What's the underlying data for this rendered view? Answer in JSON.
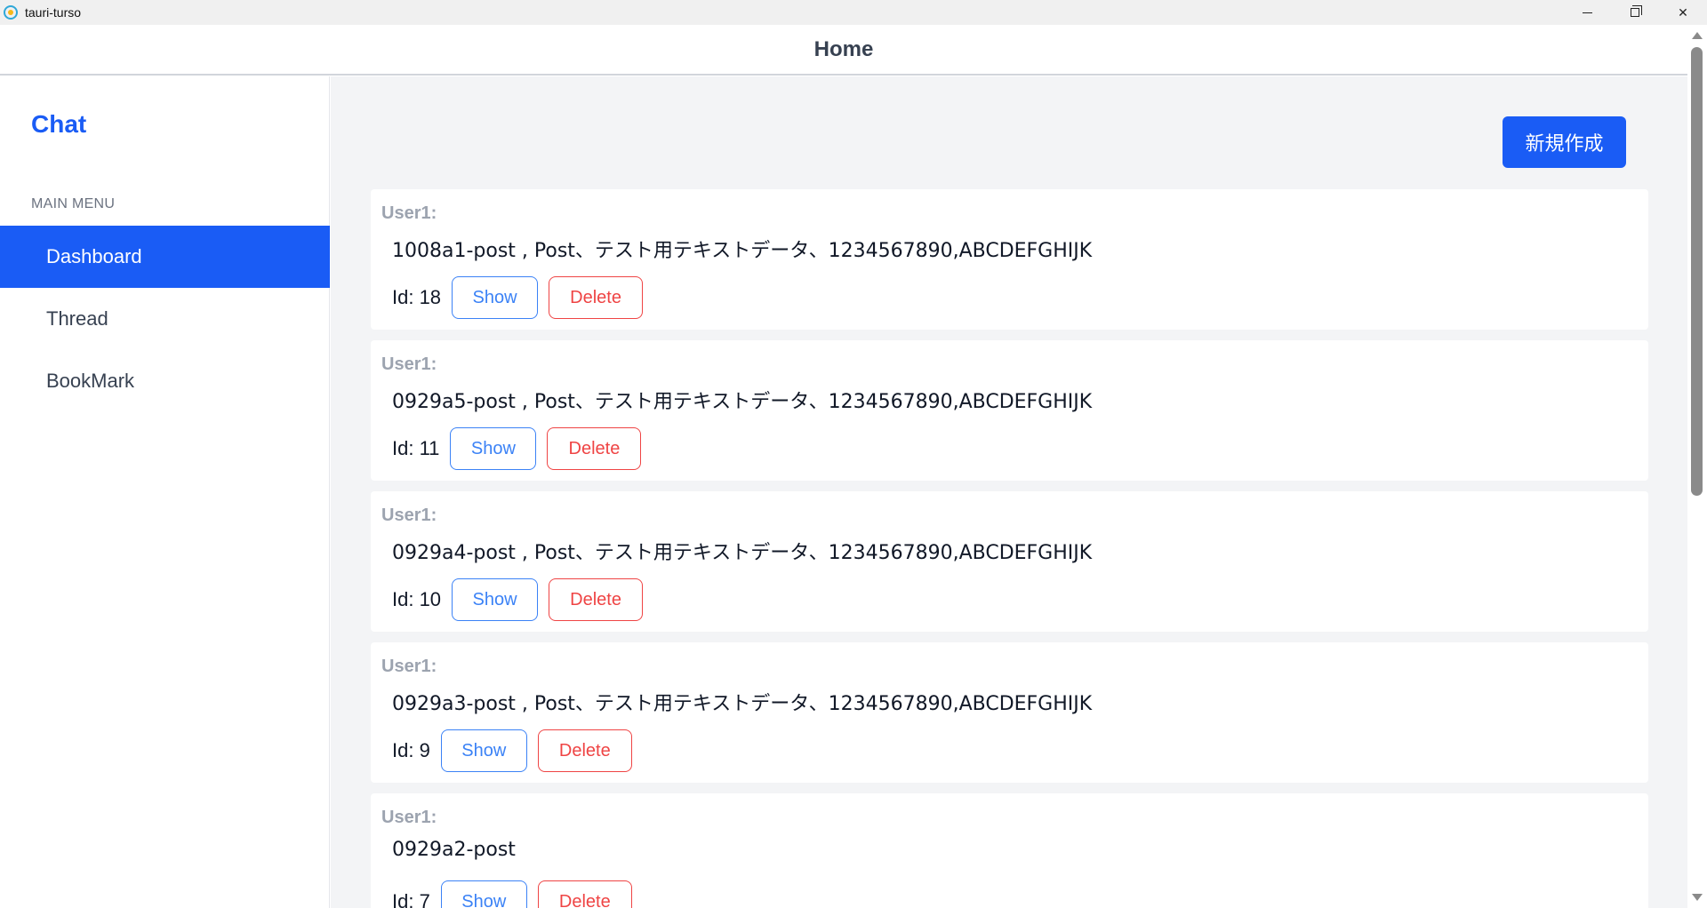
{
  "window": {
    "title": "tauri-turso",
    "icon": "tauri-app-icon",
    "controls": {
      "minimize": "minimize-icon",
      "maximize": "restore-icon",
      "close": "✕"
    }
  },
  "header": {
    "title": "Home"
  },
  "sidebar": {
    "brand": "Chat",
    "menu_heading": "MAIN MENU",
    "items": [
      {
        "label": "Dashboard",
        "active": true
      },
      {
        "label": "Thread",
        "active": false
      },
      {
        "label": "BookMark",
        "active": false
      }
    ]
  },
  "main": {
    "new_button_label": "新規作成",
    "posts": [
      {
        "user": "User1:",
        "body": "1008a1-post , Post、テスト用テキストデータ、1234567890,ABCDEFGHIJK",
        "id_label": "Id: 18",
        "show_label": "Show",
        "delete_label": "Delete"
      },
      {
        "user": "User1:",
        "body": "0929a5-post , Post、テスト用テキストデータ、1234567890,ABCDEFGHIJK",
        "id_label": "Id: 11",
        "show_label": "Show",
        "delete_label": "Delete"
      },
      {
        "user": "User1:",
        "body": "0929a4-post , Post、テスト用テキストデータ、1234567890,ABCDEFGHIJK",
        "id_label": "Id: 10",
        "show_label": "Show",
        "delete_label": "Delete"
      },
      {
        "user": "User1:",
        "body": "0929a3-post , Post、テスト用テキストデータ、1234567890,ABCDEFGHIJK",
        "id_label": "Id: 9",
        "show_label": "Show",
        "delete_label": "Delete"
      },
      {
        "user": "User1:",
        "body": "0929a2-post",
        "id_label": "Id: 7",
        "show_label": "Show",
        "delete_label": "Delete"
      }
    ]
  },
  "colors": {
    "accent": "#1a5cf5",
    "show_border": "#3b82f6",
    "delete_border": "#ef4444",
    "main_bg": "#f3f4f6"
  }
}
